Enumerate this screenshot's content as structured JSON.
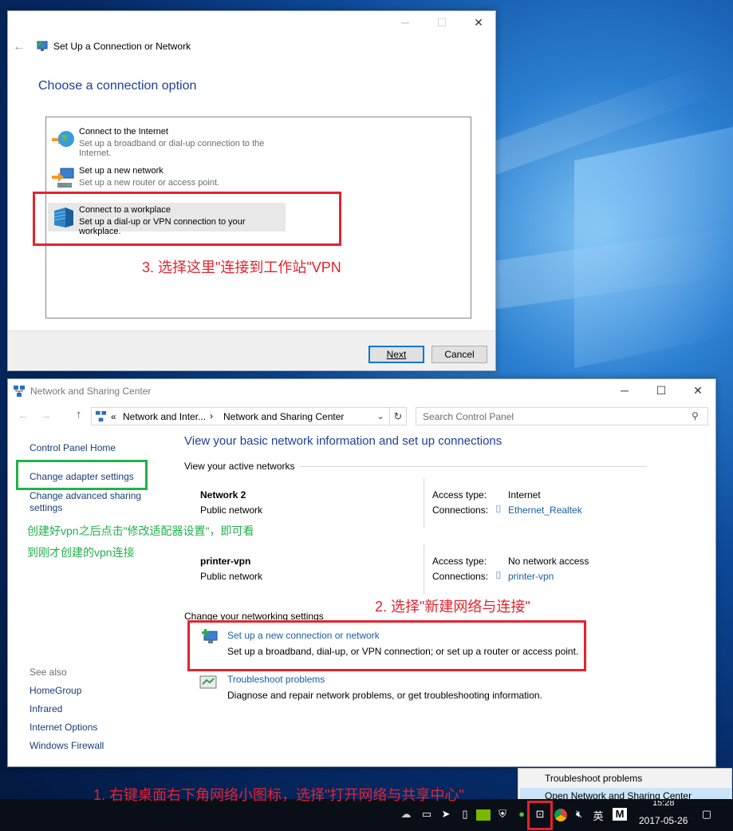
{
  "dialog": {
    "title": "Set Up a Connection or Network",
    "heading": "Choose a connection option",
    "options": [
      {
        "title": "Connect to the Internet",
        "desc": "Set up a broadband or dial-up connection to the Internet."
      },
      {
        "title": "Set up a new network",
        "desc": "Set up a new router or access point."
      },
      {
        "title": "Connect to a workplace",
        "desc": "Set up a dial-up or VPN connection to your workplace."
      }
    ],
    "next_label": "Next",
    "cancel_label": "Cancel"
  },
  "window": {
    "title": "Network and Sharing Center",
    "breadcrumb": {
      "prefix": "«",
      "parent": "Network and Inter...",
      "separator": "›",
      "current": "Network and Sharing Center"
    },
    "search_placeholder": "Search Control Panel",
    "sidebar": {
      "items": [
        "Control Panel Home",
        "Change adapter settings",
        "Change advanced sharing settings"
      ],
      "see_also_label": "See also",
      "see_also": [
        "HomeGroup",
        "Infrared",
        "Internet Options",
        "Windows Firewall"
      ]
    },
    "main": {
      "heading": "View your basic network information and set up connections",
      "active_label": "View your active networks",
      "networks": [
        {
          "name": "Network  2",
          "type": "Public network",
          "access_label": "Access type:",
          "access": "Internet",
          "conn_label": "Connections:",
          "connection": "Ethernet_Realtek"
        },
        {
          "name": "printer-vpn",
          "type": "Public network",
          "access_label": "Access type:",
          "access": "No network access",
          "conn_label": "Connections:",
          "connection": "printer-vpn"
        }
      ],
      "change_label": "Change your networking settings",
      "tasks": [
        {
          "title": "Set up a new connection or network",
          "desc": "Set up a broadband, dial-up, or VPN connection; or set up a router or access point."
        },
        {
          "title": "Troubleshoot problems",
          "desc": "Diagnose and repair network problems, or get troubleshooting information."
        }
      ]
    }
  },
  "annotations": {
    "step1": "1. 右键桌面右下角网络小图标，选择\"打开网络与共享中心\"",
    "step2": "2. 选择\"新建网络与连接\"",
    "step3": "3. 选择这里\"连接到工作站\"VPN",
    "note_line1": "创建好vpn之后点击\"修改适配器设置\"，即可看",
    "note_line2": "到刚才创建的vpn连接"
  },
  "context_menu": [
    "Troubleshoot problems",
    "Open Network and Sharing Center"
  ],
  "taskbar": {
    "ime_label": "英",
    "m_label": "M",
    "time": "15:28",
    "date": "2017-05-26"
  },
  "colors": {
    "annotation_red": "#e4232e",
    "annotation_green": "#22b14c",
    "link": "#1a5ea5",
    "heading": "#1e3f97",
    "menu_highlight": "#cce4f7"
  }
}
